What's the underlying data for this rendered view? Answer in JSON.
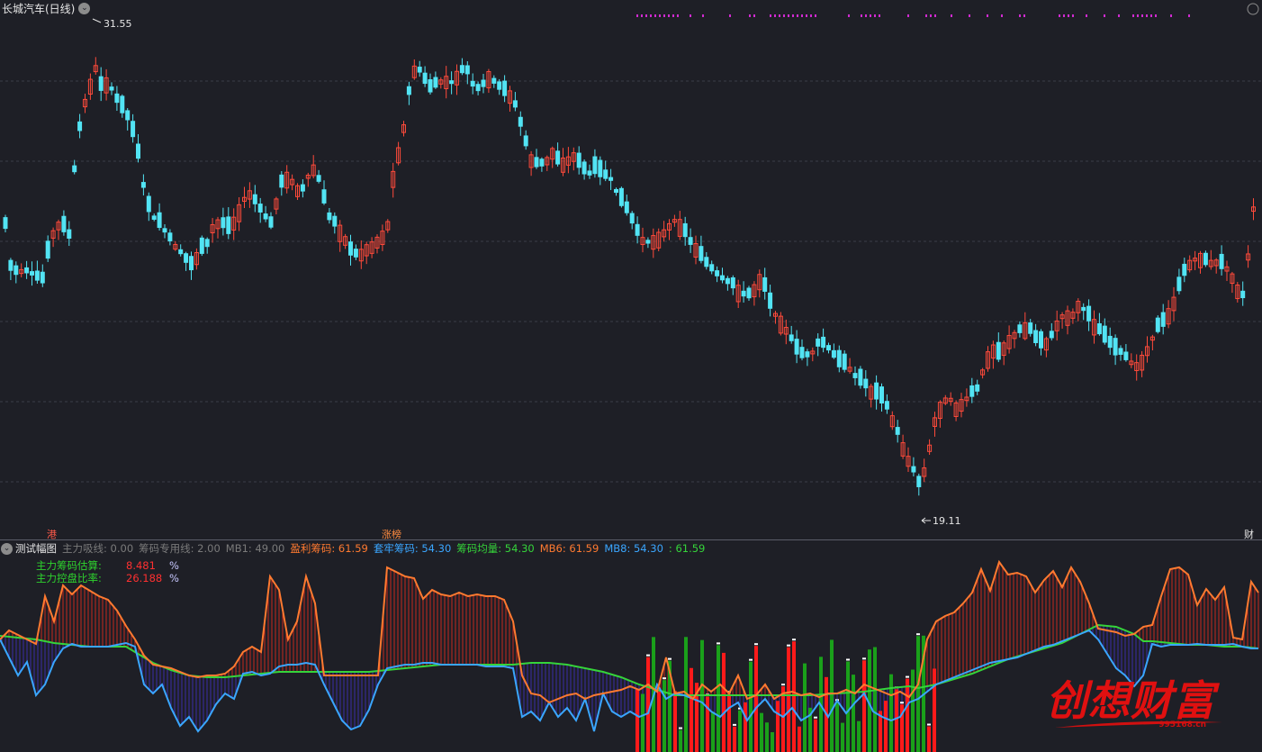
{
  "header": {
    "stock_title": "长城汽车(日线)",
    "dropdown_icon": "chevron-down-icon"
  },
  "price_chart": {
    "high_label": "31.55",
    "low_label": "19.11",
    "high_value": 31.55,
    "low_value": 19.11
  },
  "event_labels": {
    "left": "港",
    "middle": "涨榜",
    "right": "财"
  },
  "indicator": {
    "name": "测试幅图",
    "items": [
      {
        "label": "主力吸线: 0.00",
        "color": "#7a7a7a"
      },
      {
        "label": "筹码专用线: 2.00",
        "color": "#7a7a7a"
      },
      {
        "label": "MB1: 49.00",
        "color": "#7a7a7a"
      },
      {
        "label": "盈利筹码: 61.59",
        "color": "#ff7a30"
      },
      {
        "label": "套牢筹码: 54.30",
        "color": "#3aa6ff"
      },
      {
        "label": "筹码均量: 54.30",
        "color": "#35d43a"
      },
      {
        "label": "MB6: 61.59",
        "color": "#ff7a30"
      },
      {
        "label": "MB8: 54.30",
        "color": "#3aa6ff"
      },
      {
        "label": ": 61.59",
        "color": "#35d43a"
      }
    ],
    "estimates": [
      {
        "label": "主力筹码估算:",
        "value": "8.481",
        "unit": "%"
      },
      {
        "label": "主力控盘比率:",
        "value": "26.188",
        "unit": "%"
      }
    ]
  },
  "watermark": {
    "text": "创想财富",
    "site": "995168.cn"
  },
  "colors": {
    "background": "#1e1f26",
    "up_candle": "#ff4a3a",
    "down_candle": "#52e4f4",
    "profit_line": "#ff7a30",
    "trapped_line": "#3aa6ff",
    "avg_line": "#35d43a",
    "magenta_marks": "#d02ad0"
  }
}
